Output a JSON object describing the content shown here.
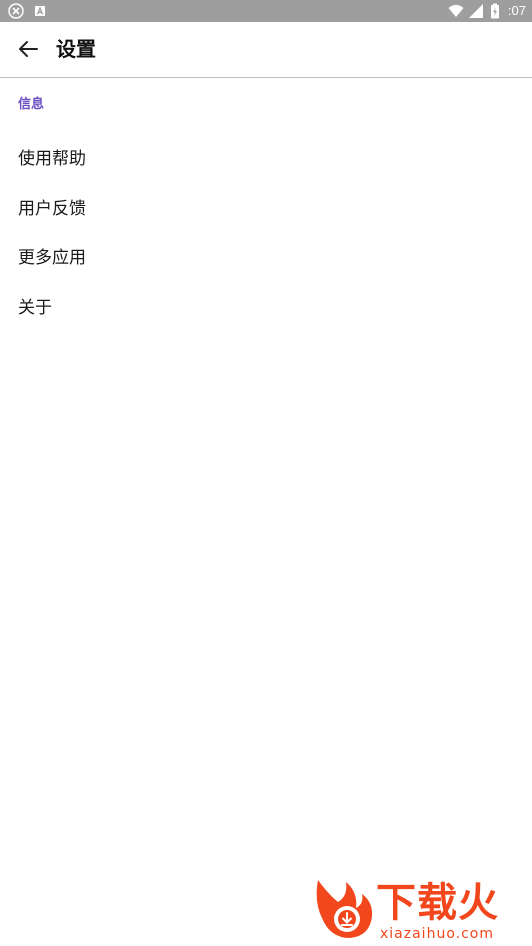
{
  "status_bar": {
    "time": ":07",
    "icons": [
      "x-circle-icon",
      "a-square-icon",
      "wifi-icon",
      "signal-icon",
      "battery-icon"
    ]
  },
  "app_bar": {
    "back_icon": "back-arrow-icon",
    "title": "设置"
  },
  "section": {
    "header": "信息",
    "items": [
      {
        "label": "使用帮助"
      },
      {
        "label": "用户反馈"
      },
      {
        "label": "更多应用"
      },
      {
        "label": "关于"
      }
    ]
  },
  "watermark": {
    "brand": "下载火",
    "url": "xiazaihuo.com"
  },
  "colors": {
    "status_bar_bg": "#9e9e9e",
    "accent": "#6a4fc2",
    "watermark": "#f2461d"
  }
}
